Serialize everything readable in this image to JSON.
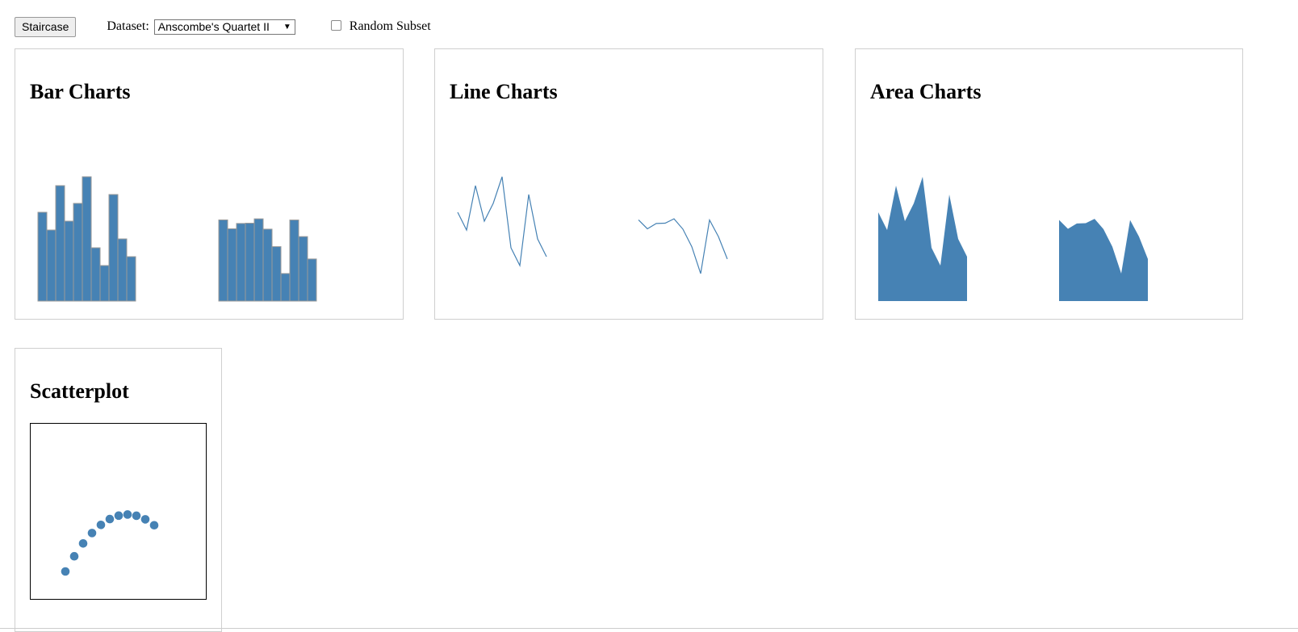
{
  "toolbar": {
    "staircase_label": "Staircase",
    "dataset_label": "Dataset:",
    "dataset_selected": "Anscombe's Quartet II",
    "random_subset_label": "Random Subset",
    "random_subset_checked": false
  },
  "panels": {
    "bar": {
      "title": "Bar Charts"
    },
    "line": {
      "title": "Line Charts"
    },
    "area": {
      "title": "Area Charts"
    },
    "scatter": {
      "title": "Scatterplot"
    }
  },
  "colors": {
    "mark": "#4682b4",
    "bar_stroke": "#999999"
  },
  "chart_data": [
    {
      "type": "bar",
      "title": "Bar Charts",
      "series": [
        {
          "values": [
            10,
            8,
            13,
            9,
            11,
            14,
            6,
            4,
            12,
            7,
            5
          ]
        },
        {
          "values": [
            9.14,
            8.14,
            8.74,
            8.77,
            9.26,
            8.1,
            6.13,
            3.1,
            9.13,
            7.26,
            4.74
          ]
        }
      ]
    },
    {
      "type": "line",
      "title": "Line Charts",
      "series": [
        {
          "values": [
            10,
            8,
            13,
            9,
            11,
            14,
            6,
            4,
            12,
            7,
            5
          ]
        },
        {
          "values": [
            9.14,
            8.14,
            8.74,
            8.77,
            9.26,
            8.1,
            6.13,
            3.1,
            9.13,
            7.26,
            4.74
          ]
        }
      ]
    },
    {
      "type": "area",
      "title": "Area Charts",
      "series": [
        {
          "values": [
            10,
            8,
            13,
            9,
            11,
            14,
            6,
            4,
            12,
            7,
            5
          ]
        },
        {
          "values": [
            9.14,
            8.14,
            8.74,
            8.77,
            9.26,
            8.1,
            6.13,
            3.1,
            9.13,
            7.26,
            4.74
          ]
        }
      ]
    },
    {
      "type": "scatter",
      "title": "Scatterplot",
      "x": [
        4,
        5,
        6,
        7,
        8,
        9,
        10,
        11,
        12,
        13,
        14
      ],
      "y": [
        3.1,
        4.74,
        6.13,
        7.26,
        8.14,
        8.77,
        9.14,
        9.26,
        9.13,
        8.74,
        8.1
      ]
    }
  ]
}
